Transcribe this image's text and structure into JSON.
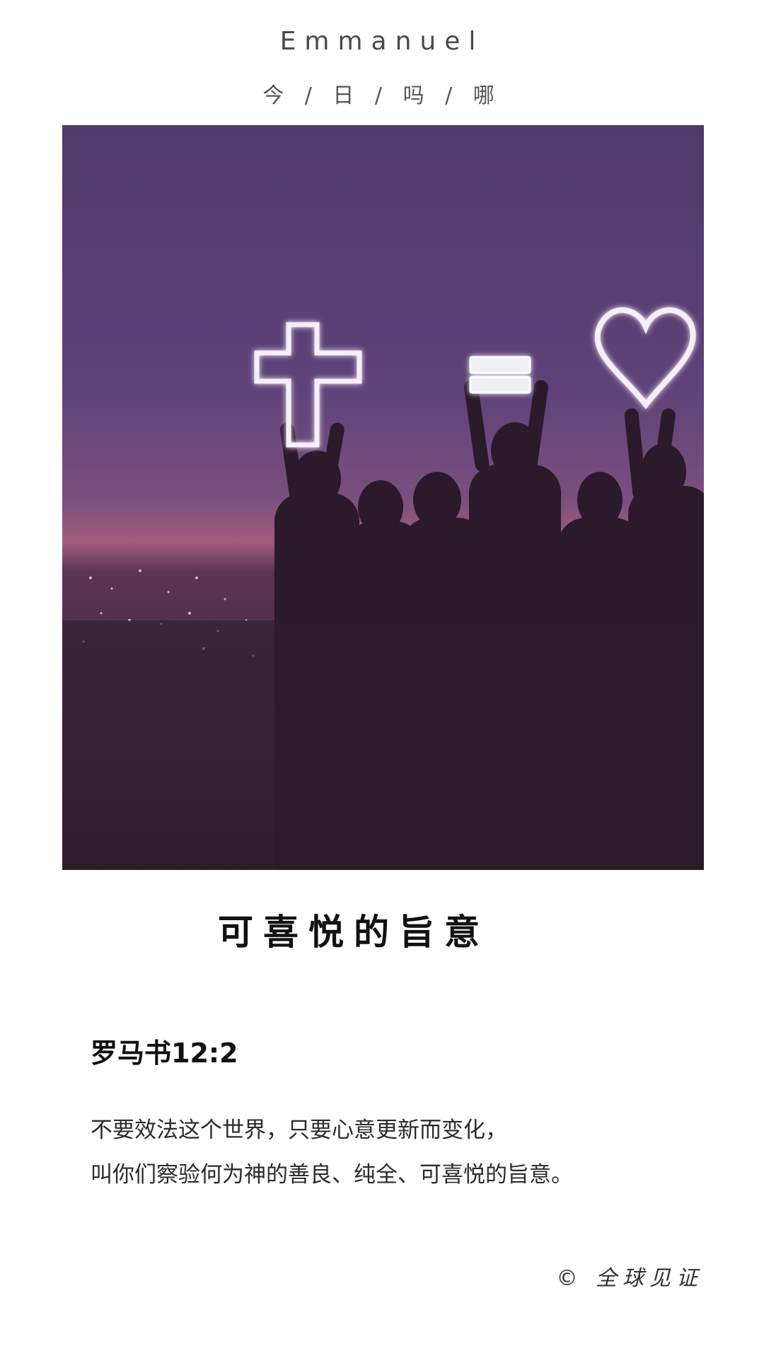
{
  "header": {
    "brand": "Emmanuel",
    "subtitle": "今 / 日 / 吗 / 哪"
  },
  "photo": {
    "description_icon": "neon-cross-equals-heart-photo"
  },
  "article": {
    "title": "可喜悦的旨意",
    "reference": "罗马书12:2",
    "verse_lines": [
      "不要效法这个世界，只要心意更新而变化，",
      "叫你们察验何为神的善良、纯全、可喜悦的旨意。"
    ]
  },
  "footer": {
    "copyright": "© 全球见证"
  }
}
